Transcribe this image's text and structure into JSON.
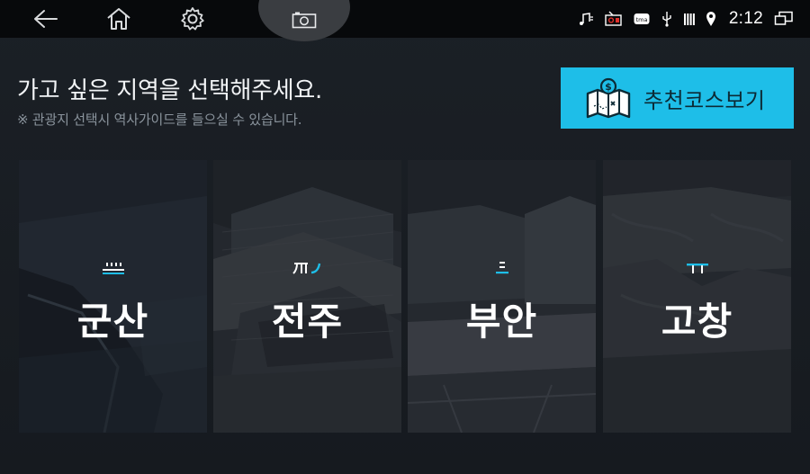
{
  "status_bar": {
    "time": "2:12",
    "icons": [
      "music-note-icon",
      "radio-record-icon",
      "tmap-icon",
      "usb-icon",
      "signal-bars-icon",
      "location-pin-icon",
      "screen-mirror-icon"
    ]
  },
  "nav": {
    "back_icon": "back-arrow-icon",
    "home_icon": "home-icon",
    "settings_icon": "gear-icon",
    "camera_icon": "camera-icon"
  },
  "main": {
    "heading": "가고 싶은 지역을 선택해주세요.",
    "subheading": "※ 관광지 선택시 역사가이드를 들으실 수 있습니다.",
    "recommend_button": {
      "label": "추천코스보기",
      "icon": "map-dollar-icon"
    },
    "regions": [
      {
        "name": "군산",
        "emblem": "gunsan-emblem-icon"
      },
      {
        "name": "전주",
        "emblem": "jeonju-emblem-icon"
      },
      {
        "name": "부안",
        "emblem": "buan-emblem-icon"
      },
      {
        "name": "고창",
        "emblem": "gochang-emblem-icon"
      }
    ]
  },
  "colors": {
    "accent": "#1ebee8",
    "topbar": "#07090b",
    "background": "#1b2026"
  }
}
